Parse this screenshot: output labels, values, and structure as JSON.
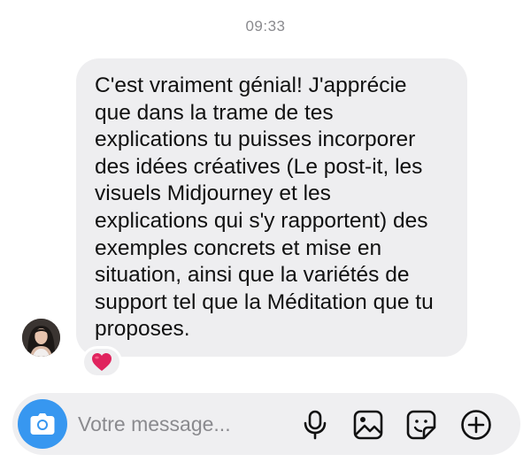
{
  "timestamp": "09:33",
  "message": {
    "lines": [
      "C'est vraiment génial! J'apprécie",
      "que dans la trame de tes",
      "explications tu puisses incorporer",
      "des idées créatives (Le post-it, les",
      "visuels Midjourney et les",
      "explications qui s'y rapportent) des",
      "exemples concrets et mise en",
      "situation, ainsi que la variétés de",
      "support tel que la Méditation que tu",
      "proposes."
    ],
    "reaction": "❤️"
  },
  "composer": {
    "placeholder": "Votre message...",
    "icons": [
      "camera-icon",
      "microphone-icon",
      "image-icon",
      "sticker-icon",
      "plus-icon"
    ]
  },
  "colors": {
    "accent": "#3797f0",
    "bubble": "#eeeef0",
    "heart": "#e0245e"
  }
}
